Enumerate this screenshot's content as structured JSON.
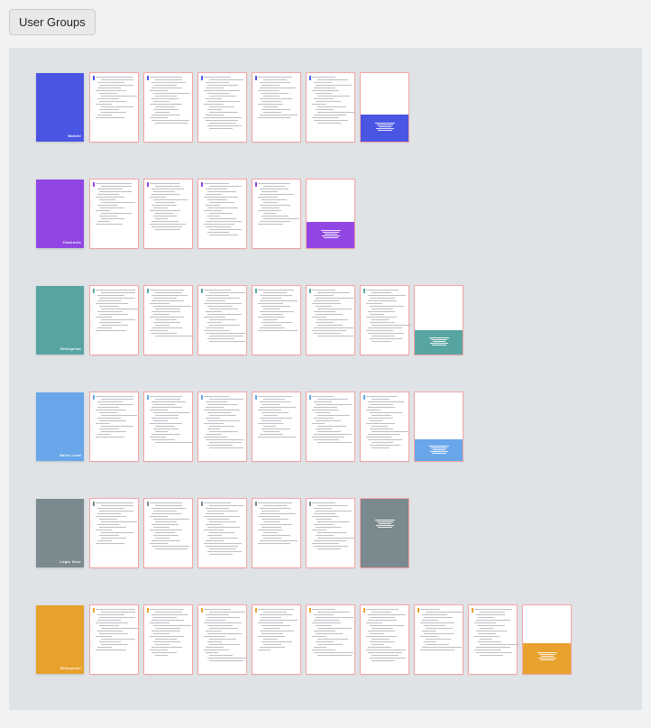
{
  "tab_label": "User Groups",
  "groups": [
    {
      "name": "Mobile",
      "accent": "#4b55e3",
      "page_count": 7,
      "band_height": 40,
      "line_pattern": [
        42,
        36,
        30,
        38,
        26,
        34,
        20,
        40,
        24,
        30,
        18,
        36,
        22,
        28,
        16,
        32,
        20
      ]
    },
    {
      "name": "Channels",
      "accent": "#9146e3",
      "page_count": 6,
      "band_height": 38,
      "line_pattern": [
        40,
        34,
        28,
        36,
        24,
        32,
        18,
        38,
        22,
        28,
        16,
        34,
        20,
        26,
        14,
        30
      ]
    },
    {
      "name": "Enterprise",
      "accent": "#57a5a1",
      "page_count": 8,
      "band_height": 36,
      "line_pattern": [
        44,
        38,
        30,
        40,
        26,
        36,
        22,
        42,
        28,
        32,
        18,
        38,
        24,
        30,
        16,
        34,
        20,
        28
      ]
    },
    {
      "name": "Sales Lead",
      "accent": "#69a6ea",
      "page_count": 8,
      "band_height": 32,
      "line_pattern": [
        42,
        36,
        28,
        38,
        24,
        34,
        20,
        40,
        26,
        30,
        16,
        36,
        22,
        28,
        14,
        32,
        18,
        26
      ]
    },
    {
      "name": "Logic User",
      "accent": "#7b8a8e",
      "page_count": 7,
      "band_height": 100,
      "line_pattern": [
        42,
        36,
        30,
        38,
        26,
        34,
        20,
        40,
        24,
        30,
        18,
        36,
        22,
        28,
        16,
        32,
        20
      ]
    },
    {
      "name": "Enterprise",
      "accent": "#e8a12c",
      "page_count": 10,
      "band_height": 45,
      "line_pattern": [
        44,
        38,
        30,
        40,
        26,
        36,
        22,
        42,
        28,
        32,
        18,
        38,
        24,
        30,
        16,
        34,
        20,
        28,
        14,
        26
      ]
    }
  ]
}
